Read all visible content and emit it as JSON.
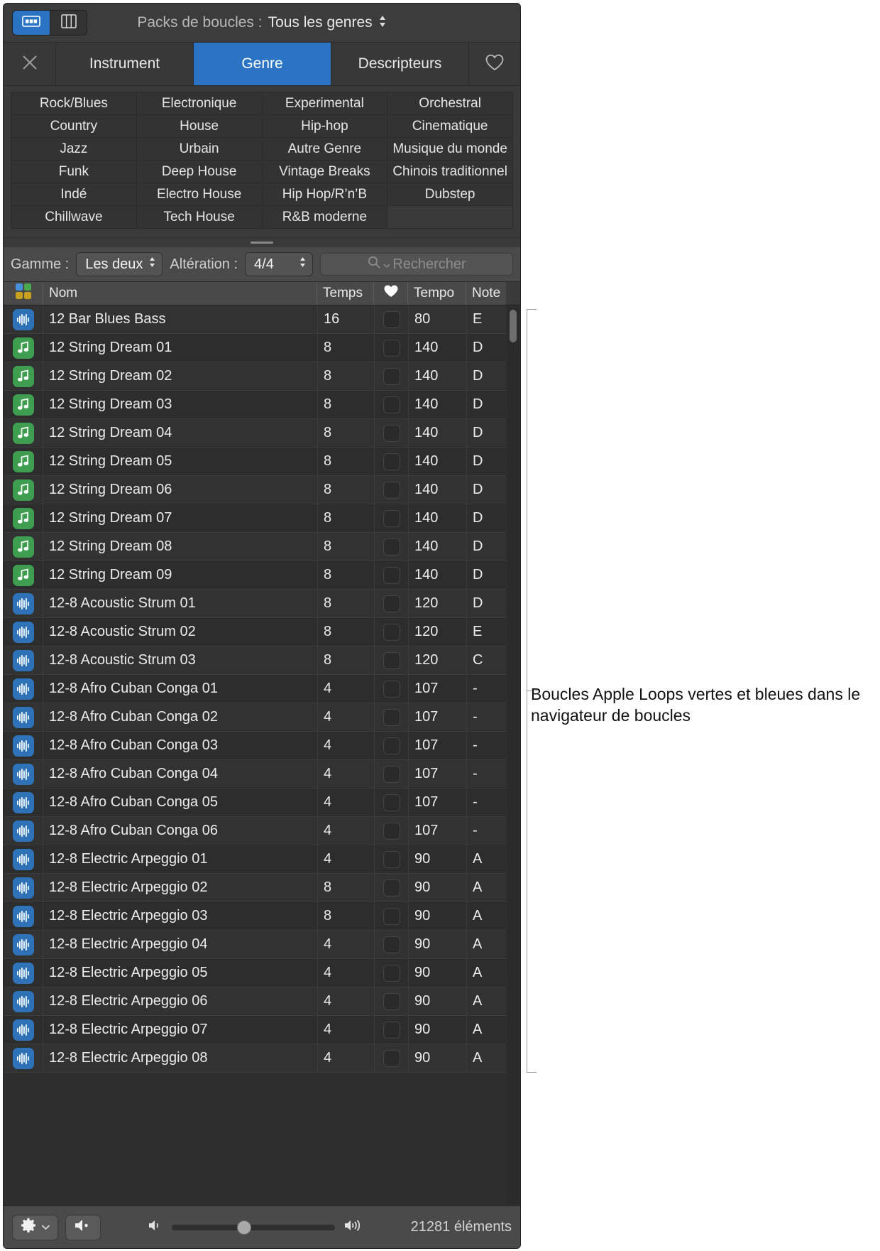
{
  "window": {
    "topbar": {
      "title": "Packs de boucles :",
      "value": "Tous les genres",
      "view_grid_icon": "grid-view-icon",
      "view_column_icon": "column-view-icon"
    },
    "tabs": {
      "close_icon": "close-icon",
      "favorite_icon": "heart-icon",
      "items": [
        {
          "label": "Instrument",
          "active": false
        },
        {
          "label": "Genre",
          "active": true
        },
        {
          "label": "Descripteurs",
          "active": false
        }
      ]
    },
    "genre_grid": {
      "rows": [
        [
          "Rock/Blues",
          "Electronique",
          "Experimental",
          "Orchestral"
        ],
        [
          "Country",
          "House",
          "Hip-hop",
          "Cinematique"
        ],
        [
          "Jazz",
          "Urbain",
          "Autre Genre",
          "Musique du monde"
        ],
        [
          "Funk",
          "Deep House",
          "Vintage Breaks",
          "Chinois traditionnel"
        ],
        [
          "Indé",
          "Electro House",
          "Hip Hop/R’n’B",
          "Dubstep"
        ],
        [
          "Chillwave",
          "Tech House",
          "R&B moderne",
          ""
        ]
      ]
    },
    "filter_bar": {
      "scale_label": "Gamme :",
      "scale_value": "Les deux",
      "signature_label": "Altération :",
      "signature_value": "4/4",
      "search_placeholder": "Rechercher",
      "search_value": "",
      "search_icon": "search-icon"
    },
    "table": {
      "columns": {
        "icon": "loop-type-icon",
        "name": "Nom",
        "beats": "Temps",
        "favorite": "heart-icon",
        "tempo": "Tempo",
        "note": "Note"
      },
      "rows": [
        {
          "type": "audio",
          "name": "12 Bar Blues Bass",
          "beats": "16",
          "tempo": "80",
          "note": "E",
          "favorite": false
        },
        {
          "type": "midi",
          "name": "12 String Dream 01",
          "beats": "8",
          "tempo": "140",
          "note": "D",
          "favorite": false
        },
        {
          "type": "midi",
          "name": "12 String Dream 02",
          "beats": "8",
          "tempo": "140",
          "note": "D",
          "favorite": false
        },
        {
          "type": "midi",
          "name": "12 String Dream 03",
          "beats": "8",
          "tempo": "140",
          "note": "D",
          "favorite": false
        },
        {
          "type": "midi",
          "name": "12 String Dream 04",
          "beats": "8",
          "tempo": "140",
          "note": "D",
          "favorite": false
        },
        {
          "type": "midi",
          "name": "12 String Dream 05",
          "beats": "8",
          "tempo": "140",
          "note": "D",
          "favorite": false
        },
        {
          "type": "midi",
          "name": "12 String Dream 06",
          "beats": "8",
          "tempo": "140",
          "note": "D",
          "favorite": false
        },
        {
          "type": "midi",
          "name": "12 String Dream 07",
          "beats": "8",
          "tempo": "140",
          "note": "D",
          "favorite": false
        },
        {
          "type": "midi",
          "name": "12 String Dream 08",
          "beats": "8",
          "tempo": "140",
          "note": "D",
          "favorite": false
        },
        {
          "type": "midi",
          "name": "12 String Dream 09",
          "beats": "8",
          "tempo": "140",
          "note": "D",
          "favorite": false
        },
        {
          "type": "audio",
          "name": "12-8 Acoustic Strum 01",
          "beats": "8",
          "tempo": "120",
          "note": "D",
          "favorite": false
        },
        {
          "type": "audio",
          "name": "12-8 Acoustic Strum 02",
          "beats": "8",
          "tempo": "120",
          "note": "E",
          "favorite": false
        },
        {
          "type": "audio",
          "name": "12-8 Acoustic Strum 03",
          "beats": "8",
          "tempo": "120",
          "note": "C",
          "favorite": false
        },
        {
          "type": "audio",
          "name": "12-8 Afro Cuban Conga 01",
          "beats": "4",
          "tempo": "107",
          "note": "-",
          "favorite": false
        },
        {
          "type": "audio",
          "name": "12-8 Afro Cuban Conga 02",
          "beats": "4",
          "tempo": "107",
          "note": "-",
          "favorite": false
        },
        {
          "type": "audio",
          "name": "12-8 Afro Cuban Conga 03",
          "beats": "4",
          "tempo": "107",
          "note": "-",
          "favorite": false
        },
        {
          "type": "audio",
          "name": "12-8 Afro Cuban Conga 04",
          "beats": "4",
          "tempo": "107",
          "note": "-",
          "favorite": false
        },
        {
          "type": "audio",
          "name": "12-8 Afro Cuban Conga 05",
          "beats": "4",
          "tempo": "107",
          "note": "-",
          "favorite": false
        },
        {
          "type": "audio",
          "name": "12-8 Afro Cuban Conga 06",
          "beats": "4",
          "tempo": "107",
          "note": "-",
          "favorite": false
        },
        {
          "type": "audio",
          "name": "12-8 Electric Arpeggio 01",
          "beats": "4",
          "tempo": "90",
          "note": "A",
          "favorite": false
        },
        {
          "type": "audio",
          "name": "12-8 Electric Arpeggio 02",
          "beats": "8",
          "tempo": "90",
          "note": "A",
          "favorite": false
        },
        {
          "type": "audio",
          "name": "12-8 Electric Arpeggio 03",
          "beats": "8",
          "tempo": "90",
          "note": "A",
          "favorite": false
        },
        {
          "type": "audio",
          "name": "12-8 Electric Arpeggio 04",
          "beats": "4",
          "tempo": "90",
          "note": "A",
          "favorite": false
        },
        {
          "type": "audio",
          "name": "12-8 Electric Arpeggio 05",
          "beats": "4",
          "tempo": "90",
          "note": "A",
          "favorite": false
        },
        {
          "type": "audio",
          "name": "12-8 Electric Arpeggio 06",
          "beats": "4",
          "tempo": "90",
          "note": "A",
          "favorite": false
        },
        {
          "type": "audio",
          "name": "12-8 Electric Arpeggio 07",
          "beats": "4",
          "tempo": "90",
          "note": "A",
          "favorite": false
        },
        {
          "type": "audio",
          "name": "12-8 Electric Arpeggio 08",
          "beats": "4",
          "tempo": "90",
          "note": "A",
          "favorite": false
        }
      ]
    },
    "bottom_bar": {
      "settings_icon": "gear-icon",
      "settings_chevron_icon": "chevron-down-icon",
      "mute_icon": "speaker-mute-icon",
      "volume_low_icon": "volume-low-icon",
      "volume_high_icon": "volume-high-icon",
      "item_count": "21281 éléments"
    }
  },
  "annotation": {
    "text": "Boucles Apple Loops vertes et bleues dans le navigateur de boucles"
  },
  "colors": {
    "accent_blue": "#2b74c4",
    "audio_loop_blue": "#2f72b8",
    "midi_loop_green": "#3f9d4f",
    "window_bg": "#3a3a3a",
    "row_bg": "#323232"
  }
}
